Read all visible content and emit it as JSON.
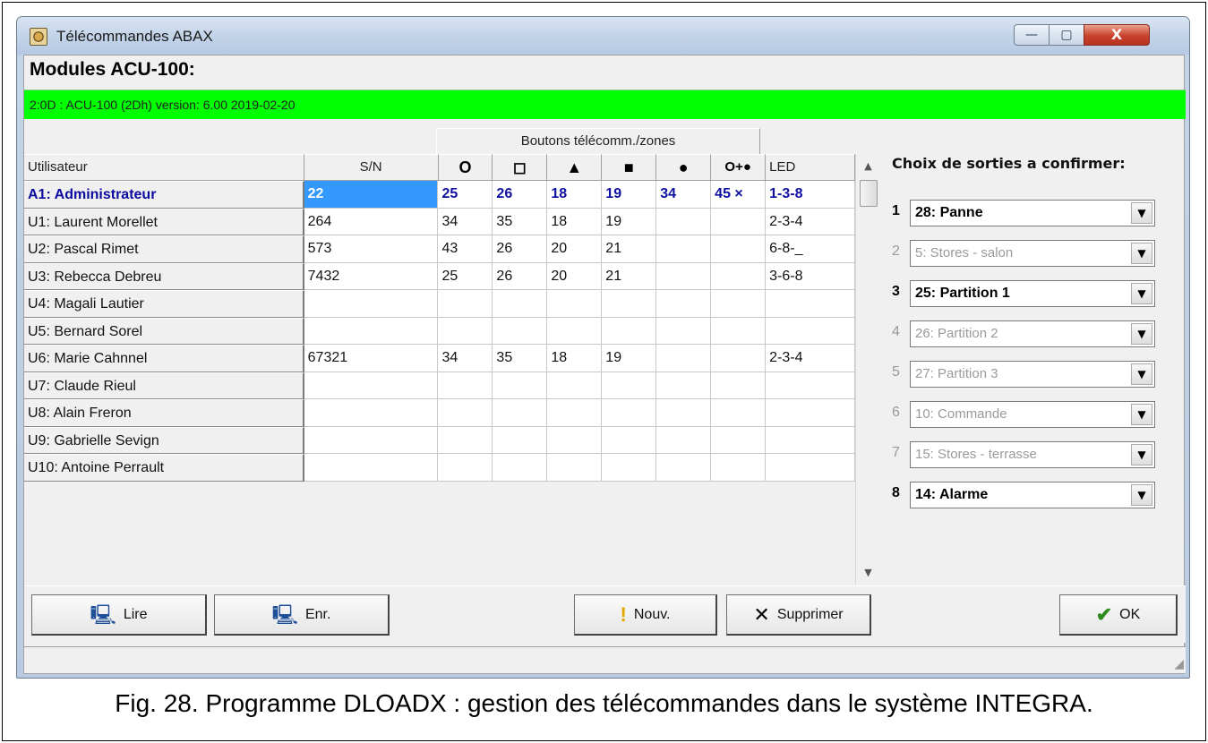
{
  "window": {
    "title": "Télécommandes ABAX",
    "minimize_glyph": "—",
    "maximize_glyph": "▢",
    "close_glyph": "X"
  },
  "modules": {
    "title": "Modules ACU-100:",
    "status_line": "2:0D :  ACU-100  (2Dh) version: 6.00 2019-02-20"
  },
  "grid": {
    "group_header": "Boutons télécomm./zones",
    "headers": {
      "user": "Utilisateur",
      "sn": "S/N",
      "b1": "O",
      "b2": "◻",
      "b3": "▲",
      "b4": "■",
      "b5": "●",
      "b6": "O+●",
      "led": "LED"
    },
    "rows": [
      {
        "user": "A1: Administrateur",
        "sn": "22",
        "b1": "25",
        "b2": "26",
        "b3": "18",
        "b4": "19",
        "b5": "34",
        "b6": "45 ×",
        "led": "1-3-8"
      },
      {
        "user": "U1: Laurent Morellet",
        "sn": "264",
        "b1": "34",
        "b2": "35",
        "b3": "18",
        "b4": "19",
        "b5": "",
        "b6": "",
        "led": "2-3-4"
      },
      {
        "user": "U2: Pascal Rimet",
        "sn": "573",
        "b1": "43",
        "b2": "26",
        "b3": "20",
        "b4": "21",
        "b5": "",
        "b6": "",
        "led": "6-8-_"
      },
      {
        "user": "U3: Rebecca Debreu",
        "sn": "7432",
        "b1": "25",
        "b2": "26",
        "b3": "20",
        "b4": "21",
        "b5": "",
        "b6": "",
        "led": "3-6-8"
      },
      {
        "user": "U4: Magali Lautier",
        "sn": "",
        "b1": "",
        "b2": "",
        "b3": "",
        "b4": "",
        "b5": "",
        "b6": "",
        "led": ""
      },
      {
        "user": "U5: Bernard Sorel",
        "sn": "",
        "b1": "",
        "b2": "",
        "b3": "",
        "b4": "",
        "b5": "",
        "b6": "",
        "led": ""
      },
      {
        "user": "U6: Marie Cahnnel",
        "sn": "67321",
        "b1": "34",
        "b2": "35",
        "b3": "18",
        "b4": "19",
        "b5": "",
        "b6": "",
        "led": "2-3-4"
      },
      {
        "user": "U7: Claude Rieul",
        "sn": "",
        "b1": "",
        "b2": "",
        "b3": "",
        "b4": "",
        "b5": "",
        "b6": "",
        "led": ""
      },
      {
        "user": "U8: Alain Freron",
        "sn": "",
        "b1": "",
        "b2": "",
        "b3": "",
        "b4": "",
        "b5": "",
        "b6": "",
        "led": ""
      },
      {
        "user": "U9: Gabrielle Sevign",
        "sn": "",
        "b1": "",
        "b2": "",
        "b3": "",
        "b4": "",
        "b5": "",
        "b6": "",
        "led": ""
      },
      {
        "user": "U10: Antoine Perrault",
        "sn": "",
        "b1": "",
        "b2": "",
        "b3": "",
        "b4": "",
        "b5": "",
        "b6": "",
        "led": ""
      }
    ],
    "scroll_up": "▲",
    "scroll_down": "▼"
  },
  "outputs": {
    "title": "Choix de sorties a confirmer:",
    "arrow": "▼",
    "items": [
      {
        "num": "1",
        "value": "28: Panne",
        "active": true
      },
      {
        "num": "2",
        "value": "5: Stores - salon",
        "active": false
      },
      {
        "num": "3",
        "value": "25: Partition 1",
        "active": true
      },
      {
        "num": "4",
        "value": "26: Partition 2",
        "active": false
      },
      {
        "num": "5",
        "value": "27: Partition 3",
        "active": false
      },
      {
        "num": "6",
        "value": "10: Commande",
        "active": false
      },
      {
        "num": "7",
        "value": "15: Stores - terrasse",
        "active": false
      },
      {
        "num": "8",
        "value": "14: Alarme",
        "active": true
      }
    ]
  },
  "buttons": {
    "read": "Lire",
    "write": "Enr.",
    "new": "Nouv.",
    "delete": "Supprimer",
    "ok": "OK"
  },
  "icons": {
    "read": "computer-read-icon",
    "write": "computer-write-icon",
    "new": "exclamation-icon",
    "delete": "x-icon",
    "ok": "checkmark-icon"
  },
  "caption": "Fig. 28. Programme DLOADX : gestion des télécommandes dans le système INTEGRA."
}
